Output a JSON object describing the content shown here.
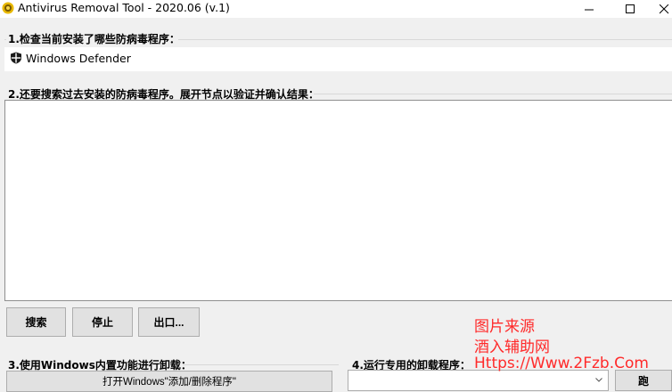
{
  "window": {
    "title": "Antivirus Removal Tool - 2020.06 (v.1)"
  },
  "section1": {
    "label": "1.检查当前安装了哪些防病毒程序：",
    "items": [
      "Windows Defender"
    ]
  },
  "section2": {
    "label": "2.还要搜索过去安装的防病毒程序。展开节点以验证并确认结果："
  },
  "buttons": {
    "search": "搜索",
    "stop": "停止",
    "export": "出口..."
  },
  "section3": {
    "label": "3.使用Windows内置功能进行卸载：",
    "open_button": "打开Windows\"添加/删除程序\""
  },
  "section4": {
    "label": "4.运行专用的卸载程序：",
    "run_button": "跑",
    "combo_value": ""
  },
  "watermark": {
    "line1": "图片来源",
    "line2": "酒入辅助网",
    "line3": "Https://Www.2Fzb.Com"
  }
}
